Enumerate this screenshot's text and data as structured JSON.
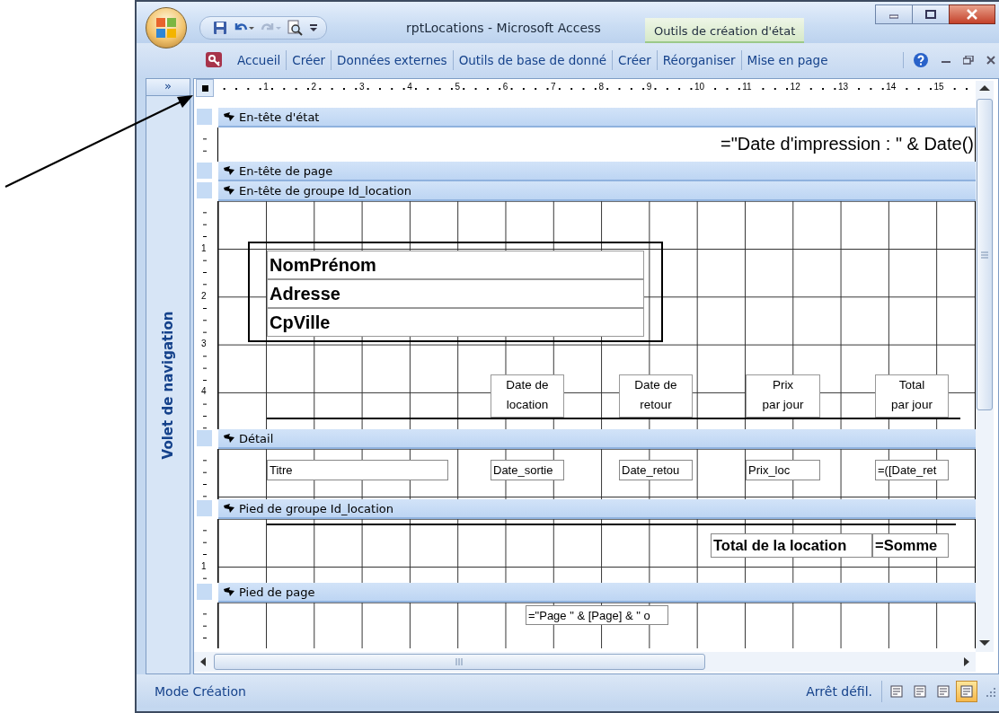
{
  "window": {
    "title": "rptLocations - Microsoft Access",
    "context_tab": "Outils de création d'état"
  },
  "ribbon_tabs": [
    {
      "label": "Accueil"
    },
    {
      "label": "Créer"
    },
    {
      "label": "Données externes"
    },
    {
      "label": "Outils de base de donné"
    },
    {
      "label": "Créer"
    },
    {
      "label": "Réorganiser"
    },
    {
      "label": "Mise en page"
    }
  ],
  "nav_pane": {
    "toggle": "»",
    "title": "Volet de navigation"
  },
  "ruler": {
    "marks": [
      "1",
      "2",
      "3",
      "4",
      "5",
      "6",
      "7",
      "8",
      "9",
      "10",
      "11",
      "12",
      "13",
      "14",
      "15"
    ]
  },
  "sections": [
    {
      "title": "En-tête d'état",
      "controls": [
        {
          "kind": "expression",
          "text": "=\"Date d'impression : \" & Date()"
        }
      ]
    },
    {
      "title": "En-tête de page"
    },
    {
      "title": "En-tête de groupe Id_location",
      "ruler_marks": [
        "1",
        "2",
        "3",
        "4"
      ],
      "controls": [
        {
          "kind": "title-field",
          "text": "NomPrénom"
        },
        {
          "kind": "title-field",
          "text": "Adresse"
        },
        {
          "kind": "title-field",
          "text": "CpVille"
        },
        {
          "kind": "label",
          "text": "Date de\nlocation"
        },
        {
          "kind": "label",
          "text": "Date de\nretour"
        },
        {
          "kind": "label",
          "text": "Prix\npar jour"
        },
        {
          "kind": "label",
          "text": "Total\npar jour"
        }
      ]
    },
    {
      "title": "Détail",
      "controls": [
        {
          "kind": "field",
          "text": "Titre"
        },
        {
          "kind": "field",
          "text": "Date_sortie"
        },
        {
          "kind": "field",
          "text": "Date_retou"
        },
        {
          "kind": "field",
          "text": "Prix_loc"
        },
        {
          "kind": "field",
          "text": "=([Date_ret"
        }
      ]
    },
    {
      "title": "Pied de groupe Id_location",
      "ruler_marks": [
        "1"
      ],
      "controls": [
        {
          "kind": "bold-label",
          "text": "Total de la location"
        },
        {
          "kind": "bold-field",
          "text": "=Somme"
        }
      ]
    },
    {
      "title": "Pied de page",
      "controls": [
        {
          "kind": "field",
          "text": "=\"Page \" & [Page] & \" o"
        }
      ]
    }
  ],
  "status_bar": {
    "mode": "Mode Création",
    "scroll_lock": "Arrêt défil.",
    "view_buttons": [
      {
        "selected": false
      },
      {
        "selected": false
      },
      {
        "selected": false
      },
      {
        "selected": true
      }
    ]
  }
}
